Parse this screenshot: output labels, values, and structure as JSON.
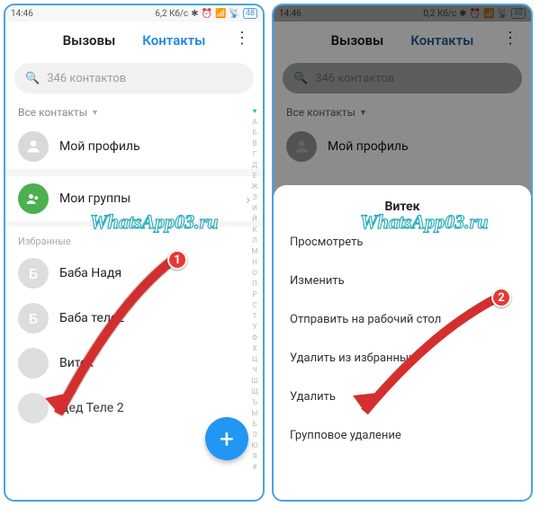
{
  "statusbar": {
    "time": "14:46",
    "net": "6,2 Кб/с",
    "net2": "0,2 Кб/с",
    "batt": "48"
  },
  "tabs": {
    "calls": "Вызовы",
    "contacts": "Контакты"
  },
  "search": {
    "placeholder": "346 контактов"
  },
  "filter": {
    "label": "Все контакты"
  },
  "profile": {
    "label": "Мой профиль"
  },
  "groups": {
    "label": "Мои группы"
  },
  "sections": {
    "fav": "Избранные"
  },
  "contacts": [
    {
      "initial": "Б",
      "name": "Баба Надя"
    },
    {
      "initial": "Б",
      "name": "Баба теле2"
    },
    {
      "initial": "",
      "name": "Витек"
    },
    {
      "initial": "",
      "name": "Дед Теле 2"
    }
  ],
  "az": [
    "А",
    "Б",
    "В",
    "Г",
    "Д",
    "Е",
    "Ж",
    "З",
    "И",
    "Й",
    "К",
    "Л",
    "М",
    "Н",
    "О",
    "П",
    "Р",
    "С",
    "Т",
    "У",
    "Ф",
    "Х",
    "Ц",
    "Ч",
    "Ш",
    "Щ",
    "Ъ",
    "Ы",
    "Ь",
    "Э",
    "Ю",
    "Я",
    "#"
  ],
  "sheet": {
    "title": "Витек",
    "items": [
      "Просмотреть",
      "Изменить",
      "Отправить на рабочий стол",
      "Удалить из избранных",
      "Удалить",
      "Групповое удаление"
    ]
  },
  "watermark": "WhatsApp03.ru",
  "anno": {
    "n1": "1",
    "n2": "2"
  }
}
